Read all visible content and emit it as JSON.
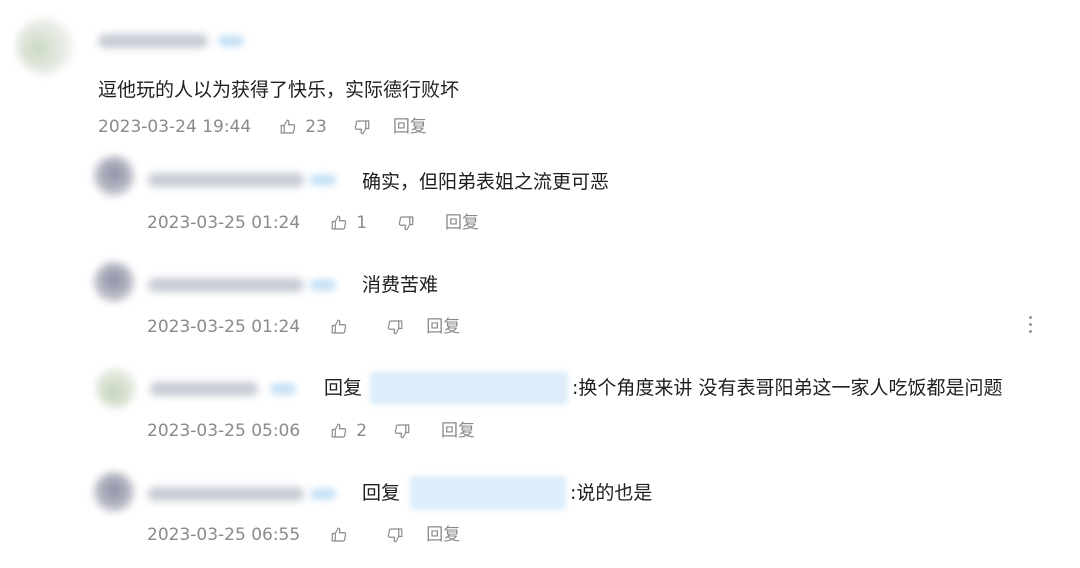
{
  "comments": [
    {
      "text": "逗他玩的人以为获得了快乐，实际德行败坏",
      "time": "2023-03-24 19:44",
      "likes": "23",
      "reply_label": "回复"
    }
  ],
  "replies": [
    {
      "text": "确实，但阳弟表姐之流更可恶",
      "time": "2023-03-25 01:24",
      "likes": "1",
      "reply_label": "回复"
    },
    {
      "text": "消费苦难",
      "time": "2023-03-25 01:24",
      "likes": "",
      "reply_label": "回复"
    },
    {
      "prefix": "回复",
      "text": ":换个角度来讲 没有表哥阳弟这一家人吃饭都是问题",
      "time": "2023-03-25 05:06",
      "likes": "2",
      "reply_label": "回复"
    },
    {
      "prefix": "回复",
      "text": ":说的也是",
      "time": "2023-03-25 06:55",
      "likes": "",
      "reply_label": "回复"
    }
  ],
  "colors": {
    "meta": "#8a8a8a",
    "text": "#1f1f1f",
    "mention": "#dcecf8"
  },
  "icons": [
    "thumb-up-icon",
    "thumb-down-icon",
    "more-vertical-icon"
  ]
}
